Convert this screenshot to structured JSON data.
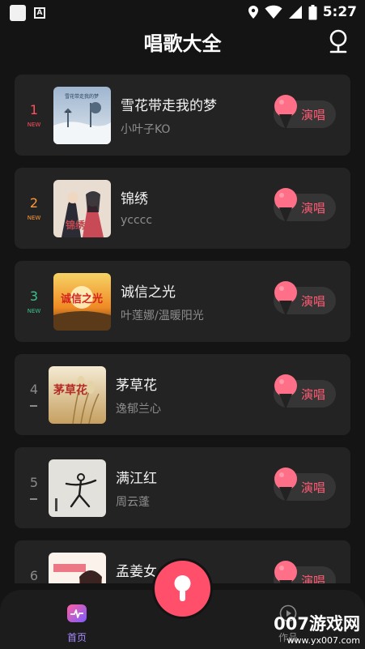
{
  "status_bar": {
    "time": "5:27",
    "badge": "A"
  },
  "header": {
    "title": "唱歌大全"
  },
  "sing_label": "演唱",
  "songs": [
    {
      "rank": "1",
      "tag": "NEW",
      "title": "雪花带走我的梦",
      "artist": "小叶子KO",
      "cover_text": "雪花带走我的梦",
      "rank_color": "#ff4f5e"
    },
    {
      "rank": "2",
      "tag": "NEW",
      "title": "锦绣",
      "artist": "ycccc",
      "cover_text": "锦绣",
      "rank_color": "#ff9a3c"
    },
    {
      "rank": "3",
      "tag": "NEW",
      "title": "诚信之光",
      "artist": "叶莲娜/温暖阳光",
      "cover_text": "诚信之光",
      "rank_color": "#3cc38d"
    },
    {
      "rank": "4",
      "tag": "",
      "title": "茅草花",
      "artist": "逸郁兰心",
      "cover_text": "茅草花",
      "rank_color": "#8a8a8a"
    },
    {
      "rank": "5",
      "tag": "",
      "title": "满江红",
      "artist": "周云蓬",
      "cover_text": "",
      "rank_color": "#8a8a8a"
    },
    {
      "rank": "6",
      "tag": "",
      "title": "孟姜女",
      "artist": "",
      "cover_text": "",
      "rank_color": "#8a8a8a"
    }
  ],
  "tabbar": {
    "home_label": "首页",
    "works_label": "作品"
  },
  "watermark": {
    "main": "007游戏网",
    "url": "www.yx007.com"
  },
  "colors": {
    "accent": "#ff4f6a",
    "background": "#141414",
    "card": "#232323"
  }
}
